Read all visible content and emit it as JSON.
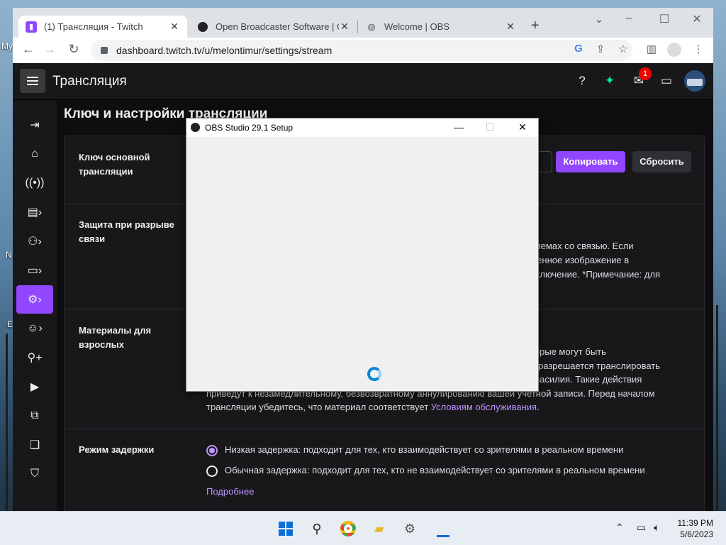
{
  "desktop": {
    "fragments": [
      "My",
      "N",
      "E"
    ]
  },
  "browser": {
    "tabs": [
      {
        "title": "(1) Трансляция - Twitch",
        "active": true
      },
      {
        "title": "Open Broadcaster Software | OBS",
        "active": false
      },
      {
        "title": "Welcome | OBS",
        "active": false
      }
    ],
    "url": "dashboard.twitch.tv/u/melontimur/settings/stream",
    "new_tab_label": "+",
    "win_controls": {
      "minimize": "–",
      "maximize": "☐",
      "close": "✕"
    }
  },
  "twitch": {
    "header_title": "Трансляция",
    "notification_count": "1",
    "accent_color": "#9147ff",
    "section_heading": "Ключ и настройки трансляции",
    "stream_key": {
      "label": "Ключ основной трансляции",
      "copy_button": "Копировать",
      "reset_button": "Сбросить"
    },
    "disconnect_protection": {
      "label": "Защита при разрыве связи",
      "lines": [
        "облемах со связью. Если",
        "еменное изображение в",
        "одключение. *Примечание: для"
      ]
    },
    "mature_content": {
      "label": "Материалы для взрослых",
      "lines": [
        "оторые могут быть",
        "не разрешается транслировать",
        "ы насилия. Такие действия",
        "приведут к незамедлительному, безвозвратному аннулированию вашей учетной записи. Перед началом"
      ],
      "last_line_prefix": "трансляции убедитесь, что материал соответствует ",
      "terms_link": "Условиям обслуживания",
      "last_line_suffix": "."
    },
    "latency": {
      "label": "Режим задержки",
      "options": [
        {
          "text": "Низкая задержка: подходит для тех, кто взаимодействует со зрителями в реальном времени",
          "selected": true
        },
        {
          "text": "Обычная задержка: подходит для тех, кто не взаимодействует со зрителями в реальном времени",
          "selected": false
        }
      ],
      "more_link": "Подробнее"
    }
  },
  "dialog": {
    "title": "OBS Studio 29.1 Setup",
    "controls": {
      "minimize": "—",
      "maximize": "☐",
      "close": "✕"
    }
  },
  "taskbar": {
    "time": "11:39 PM",
    "date": "5/6/2023"
  }
}
